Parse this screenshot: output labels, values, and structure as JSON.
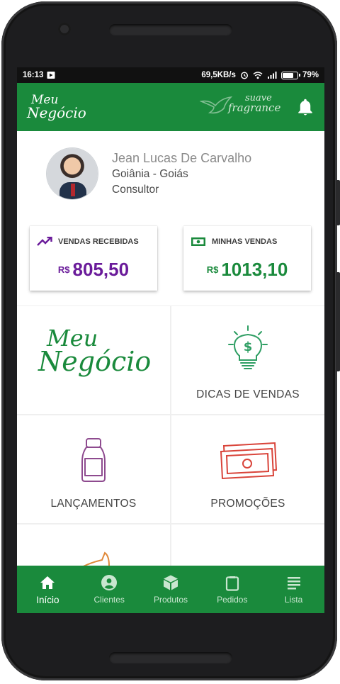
{
  "status_bar": {
    "time": "16:13",
    "net_speed": "69,5KB/s",
    "battery": "79%",
    "battery_level": 0.79
  },
  "app_bar": {
    "logo_line1": "Meu",
    "logo_line2": "Negócio",
    "brand_line1": "suave",
    "brand_line2": "fragrance",
    "notification_icon": "bell-icon"
  },
  "profile": {
    "name": "Jean Lucas De Carvalho",
    "city": "Goiânia - Goiás",
    "role": "Consultor"
  },
  "cards": {
    "received": {
      "label": "VENDAS RECEBIDAS",
      "currency": "R$",
      "value": "805,50",
      "color": "#6a1b9a",
      "icon": "trending-up-icon"
    },
    "mine": {
      "label": "MINHAS VENDAS",
      "currency": "R$",
      "value": "1013,10",
      "color": "#1a8a3c",
      "icon": "money-icon"
    }
  },
  "tiles": {
    "logo_line1": "Meu",
    "logo_line2": "Negócio",
    "dicas": "DICAS DE VENDAS",
    "lancamentos": "LANÇAMENTOS",
    "promocoes": "PROMOÇÕES"
  },
  "nav": {
    "items": [
      {
        "label": "Início",
        "icon": "home-icon",
        "active": true
      },
      {
        "label": "Clientes",
        "icon": "account-circle-icon"
      },
      {
        "label": "Produtos",
        "icon": "package-icon"
      },
      {
        "label": "Pedidos",
        "icon": "clipboard-icon"
      },
      {
        "label": "Lista",
        "icon": "list-icon"
      }
    ]
  },
  "colors": {
    "primary": "#1a8a3c",
    "accent_purple": "#6a1b9a",
    "promo_red": "#d9443a",
    "lancamento_purple": "#8e4b8f"
  }
}
